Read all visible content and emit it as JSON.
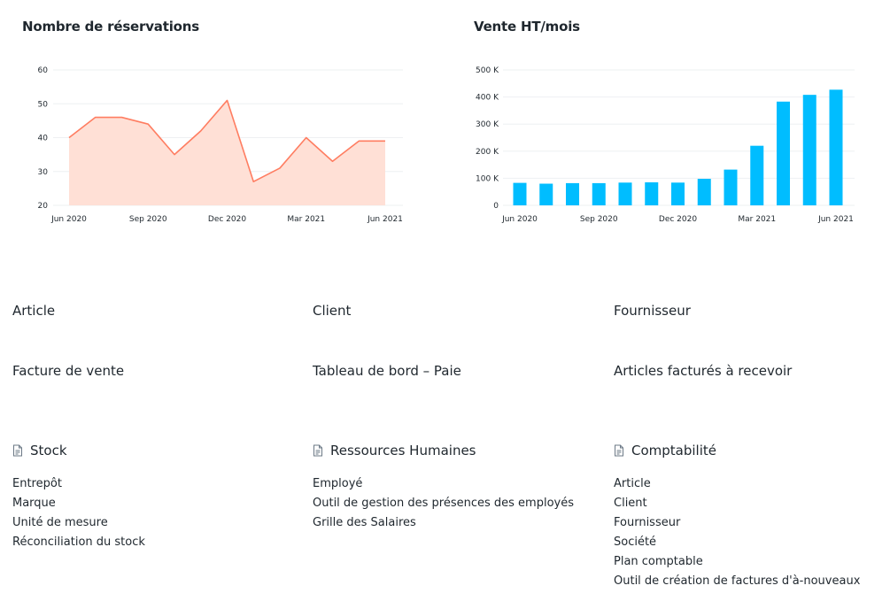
{
  "charts": {
    "left": {
      "title": "Nombre de réservations",
      "x_ticks": [
        "Jun 2020",
        "Sep 2020",
        "Dec 2020",
        "Mar 2021",
        "Jun 2021"
      ],
      "y_ticks": [
        "20",
        "30",
        "40",
        "50",
        "60"
      ]
    },
    "right": {
      "title": "Vente HT/mois",
      "x_ticks": [
        "Jun 2020",
        "Sep 2020",
        "Dec 2020",
        "Mar 2021",
        "Jun 2021"
      ],
      "y_ticks": [
        "0",
        "100 K",
        "200 K",
        "300 K",
        "400 K",
        "500 K"
      ]
    }
  },
  "chart_data": [
    {
      "type": "area",
      "title": "Nombre de réservations",
      "x": [
        "Jun 2020",
        "Jul 2020",
        "Aug 2020",
        "Sep 2020",
        "Oct 2020",
        "Nov 2020",
        "Dec 2020",
        "Jan 2021",
        "Feb 2021",
        "Mar 2021",
        "Apr 2021",
        "May 2021",
        "Jun 2021"
      ],
      "values": [
        40,
        46,
        46,
        44,
        35,
        42,
        51,
        27,
        31,
        40,
        33,
        39,
        39
      ],
      "ylim": [
        20,
        60
      ],
      "color": "#ff7d61",
      "fill": "#ffe0d6",
      "grid": true
    },
    {
      "type": "bar",
      "title": "Vente HT/mois",
      "categories": [
        "Jun 2020",
        "Jul 2020",
        "Aug 2020",
        "Sep 2020",
        "Oct 2020",
        "Nov 2020",
        "Dec 2020",
        "Jan 2021",
        "Feb 2021",
        "Mar 2021",
        "Apr 2021",
        "May 2021",
        "Jun 2021"
      ],
      "values": [
        83000,
        80000,
        82000,
        82000,
        84000,
        85000,
        84000,
        98000,
        132000,
        220000,
        383000,
        408000,
        427000
      ],
      "ylim": [
        0,
        500000
      ],
      "color": "#00bdff",
      "grid": true
    }
  ],
  "shortcuts": [
    {
      "label": "Article"
    },
    {
      "label": "Client"
    },
    {
      "label": "Fournisseur"
    },
    {
      "label": "Facture de vente"
    },
    {
      "label": "Tableau de bord – Paie"
    },
    {
      "label": "Articles facturés à recevoir"
    }
  ],
  "sections": [
    {
      "title": "Stock",
      "icon": "document-icon",
      "links": [
        "Entrepôt",
        "Marque",
        "Unité de mesure",
        "Réconciliation du stock"
      ]
    },
    {
      "title": "Ressources Humaines",
      "icon": "document-icon",
      "links": [
        "Employé",
        "Outil de gestion des présences des employés",
        "Grille des Salaires"
      ]
    },
    {
      "title": "Comptabilité",
      "icon": "document-icon",
      "links": [
        "Article",
        "Client",
        "Fournisseur",
        "Société",
        "Plan comptable",
        "Outil de création de factures d'à-nouveaux"
      ]
    }
  ]
}
